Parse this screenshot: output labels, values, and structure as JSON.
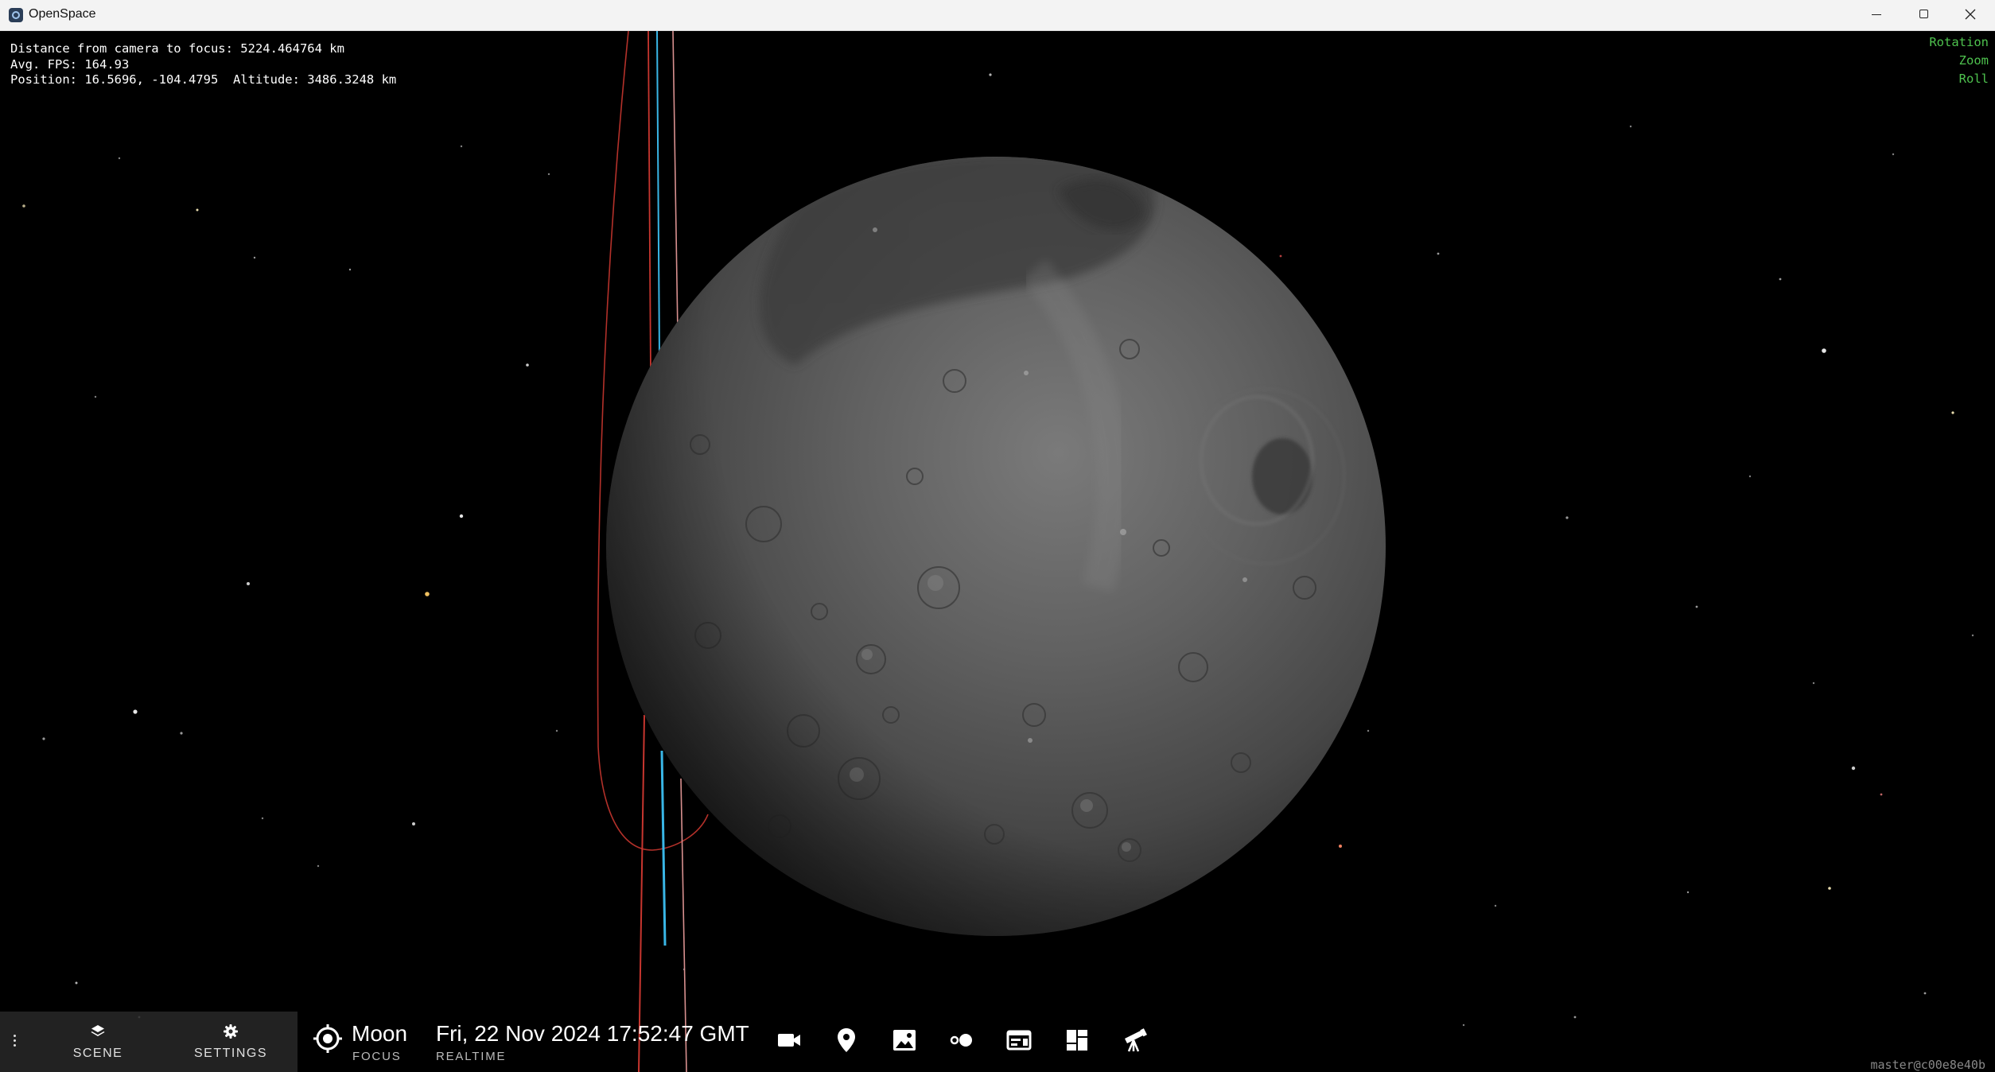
{
  "window": {
    "title": "OpenSpace"
  },
  "overlay": {
    "distance_line": "Distance from camera to focus: 5224.464764 km",
    "fps_line": "Avg. FPS: 164.93",
    "position_line": "Position: 16.5696, -104.4795  Altitude: 3486.3248 km"
  },
  "navigation_indicators": [
    "Rotation",
    "Zoom",
    "Roll"
  ],
  "bottom_bar": {
    "scene_label": "SCENE",
    "settings_label": "SETTINGS",
    "focus": {
      "name": "Moon",
      "label": "FOCUS"
    },
    "time": {
      "value": "Fri, 22 Nov 2024 17:52:47 GMT",
      "label": "REALTIME"
    },
    "tools": [
      "video-camera-icon",
      "map-pin-icon",
      "image-icon",
      "dots-icon",
      "browser-window-icon",
      "dashboard-icon",
      "telescope-icon"
    ]
  },
  "version_text": "master@c00e8e40b",
  "colors": {
    "indicator_green": "#4ec24e",
    "trail_red": "#c8362f",
    "trail_cyan": "#39b6e6",
    "trail_pink": "#d8908f"
  }
}
